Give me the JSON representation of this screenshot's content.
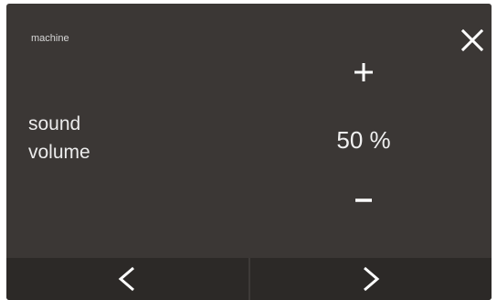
{
  "breadcrumb": "machine",
  "setting": {
    "label_line1": "sound",
    "label_line2": "volume",
    "value_text": "50 %",
    "value_percent": 50
  },
  "icons": {
    "close": "close-icon",
    "increase": "plus-icon",
    "decrease": "minus-icon",
    "previous": "chevron-left-icon",
    "next": "chevron-right-icon"
  },
  "colors": {
    "background": "#3b3735",
    "nav_bar": "#2c2927",
    "text": "#eeeeee"
  }
}
